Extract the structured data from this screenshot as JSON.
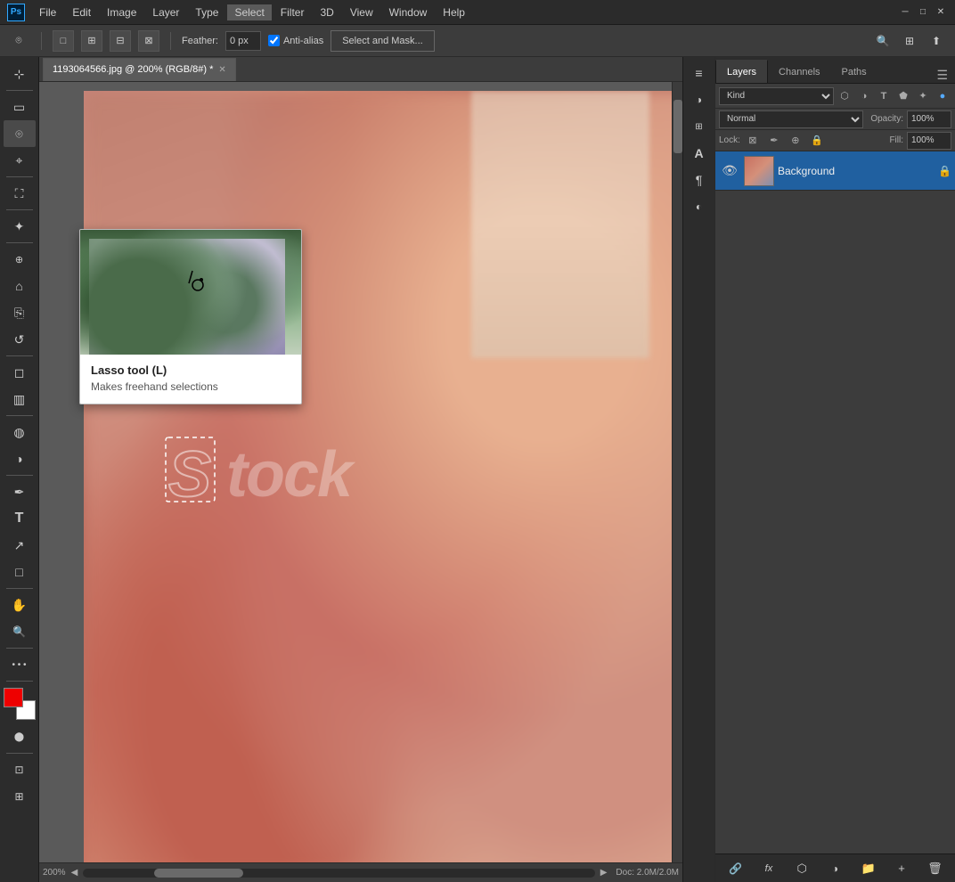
{
  "titlebar": {
    "app_logo": "Ps",
    "menus": [
      "File",
      "Edit",
      "Image",
      "Layer",
      "Type",
      "Select",
      "Filter",
      "3D",
      "View",
      "Window",
      "Help"
    ],
    "win_minimize": "─",
    "win_maximize": "□",
    "win_close": "✕"
  },
  "options_bar": {
    "feather_label": "Feather:",
    "feather_value": "0 px",
    "antialias_label": "Anti-alias",
    "antialias_checked": true,
    "select_mask_btn": "Select and Mask..."
  },
  "tab": {
    "filename": "1193064566.jpg @ 200% (RGB/8#) *",
    "close": "✕"
  },
  "tooltip": {
    "title": "Lasso tool (L)",
    "description": "Makes freehand selections"
  },
  "canvas": {
    "zoom": "200%",
    "doc_info": "Doc: 2.0M/2.0M",
    "watermark": "Stock"
  },
  "layers_panel": {
    "tabs": [
      "Layers",
      "Channels",
      "Paths"
    ],
    "active_tab": "Layers",
    "filter_placeholder": "Kind",
    "blend_mode": "Normal",
    "opacity_label": "Opacity:",
    "opacity_value": "100%",
    "lock_label": "Lock:",
    "fill_label": "Fill:",
    "fill_value": "100%",
    "layers": [
      {
        "name": "Background",
        "visible": true,
        "locked": true,
        "selected": true
      }
    ],
    "bottom_icons": [
      "link-icon",
      "fx-icon",
      "mask-icon",
      "adjustment-icon",
      "folder-icon",
      "new-layer-icon",
      "delete-icon"
    ]
  },
  "tools": {
    "left": [
      {
        "name": "move-tool",
        "icon": "⊹",
        "title": "Move"
      },
      {
        "name": "rectangular-marquee-tool",
        "icon": "▭",
        "title": "Rectangular Marquee"
      },
      {
        "name": "lasso-tool",
        "icon": "⌾",
        "title": "Lasso",
        "active": true
      },
      {
        "name": "quick-selection-tool",
        "icon": "⌖",
        "title": "Quick Selection"
      },
      {
        "name": "crop-tool",
        "icon": "⛶",
        "title": "Crop"
      },
      {
        "name": "eyedropper-tool",
        "icon": "🔍",
        "title": "Eyedropper"
      },
      {
        "name": "healing-brush-tool",
        "icon": "✦",
        "title": "Healing Brush"
      },
      {
        "name": "brush-tool",
        "icon": "🖌",
        "title": "Brush"
      },
      {
        "name": "clone-stamp-tool",
        "icon": "⎘",
        "title": "Clone Stamp"
      },
      {
        "name": "history-brush-tool",
        "icon": "↺",
        "title": "History Brush"
      },
      {
        "name": "eraser-tool",
        "icon": "◻",
        "title": "Eraser"
      },
      {
        "name": "gradient-tool",
        "icon": "▥",
        "title": "Gradient"
      },
      {
        "name": "blur-tool",
        "icon": "◍",
        "title": "Blur"
      },
      {
        "name": "dodge-tool",
        "icon": "◑",
        "title": "Dodge"
      },
      {
        "name": "pen-tool",
        "icon": "✒",
        "title": "Pen"
      },
      {
        "name": "text-tool",
        "icon": "T",
        "title": "Text"
      },
      {
        "name": "path-selection-tool",
        "icon": "↗",
        "title": "Path Selection"
      },
      {
        "name": "rectangle-tool",
        "icon": "□",
        "title": "Rectangle"
      },
      {
        "name": "hand-tool",
        "icon": "✋",
        "title": "Hand"
      },
      {
        "name": "zoom-tool",
        "icon": "🔍",
        "title": "Zoom"
      },
      {
        "name": "extra-tools",
        "icon": "•••",
        "title": "Extra"
      }
    ]
  }
}
